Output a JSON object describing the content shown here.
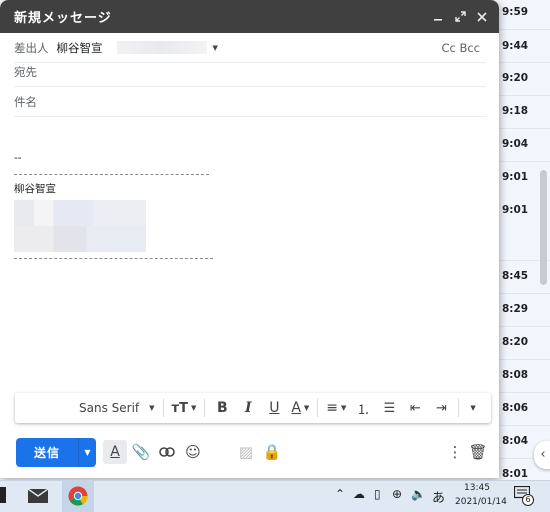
{
  "compose": {
    "title": "新規メッセージ",
    "from_label": "差出人",
    "from_name": "柳谷智宣",
    "cc_bcc": "Cc Bcc",
    "to_label": "宛先",
    "subject_label": "件名",
    "signature_dash": "--",
    "signature_name": "柳谷智宣"
  },
  "toolbar": {
    "font_name": "Sans Serif"
  },
  "actions": {
    "send_label": "送信"
  },
  "inbox_times": [
    "9:59",
    "9:44",
    "9:20",
    "9:18",
    "9:04",
    "9:01",
    "9:01",
    "8:45",
    "8:29",
    "8:20",
    "8:08",
    "8:06",
    "8:04",
    "8:01"
  ],
  "taskbar": {
    "ime_label": "あ",
    "time": "13:45",
    "date": "2021/01/14",
    "notification_count": "6"
  },
  "colors": {
    "send_button": "#1a73e8",
    "header": "#404040"
  }
}
